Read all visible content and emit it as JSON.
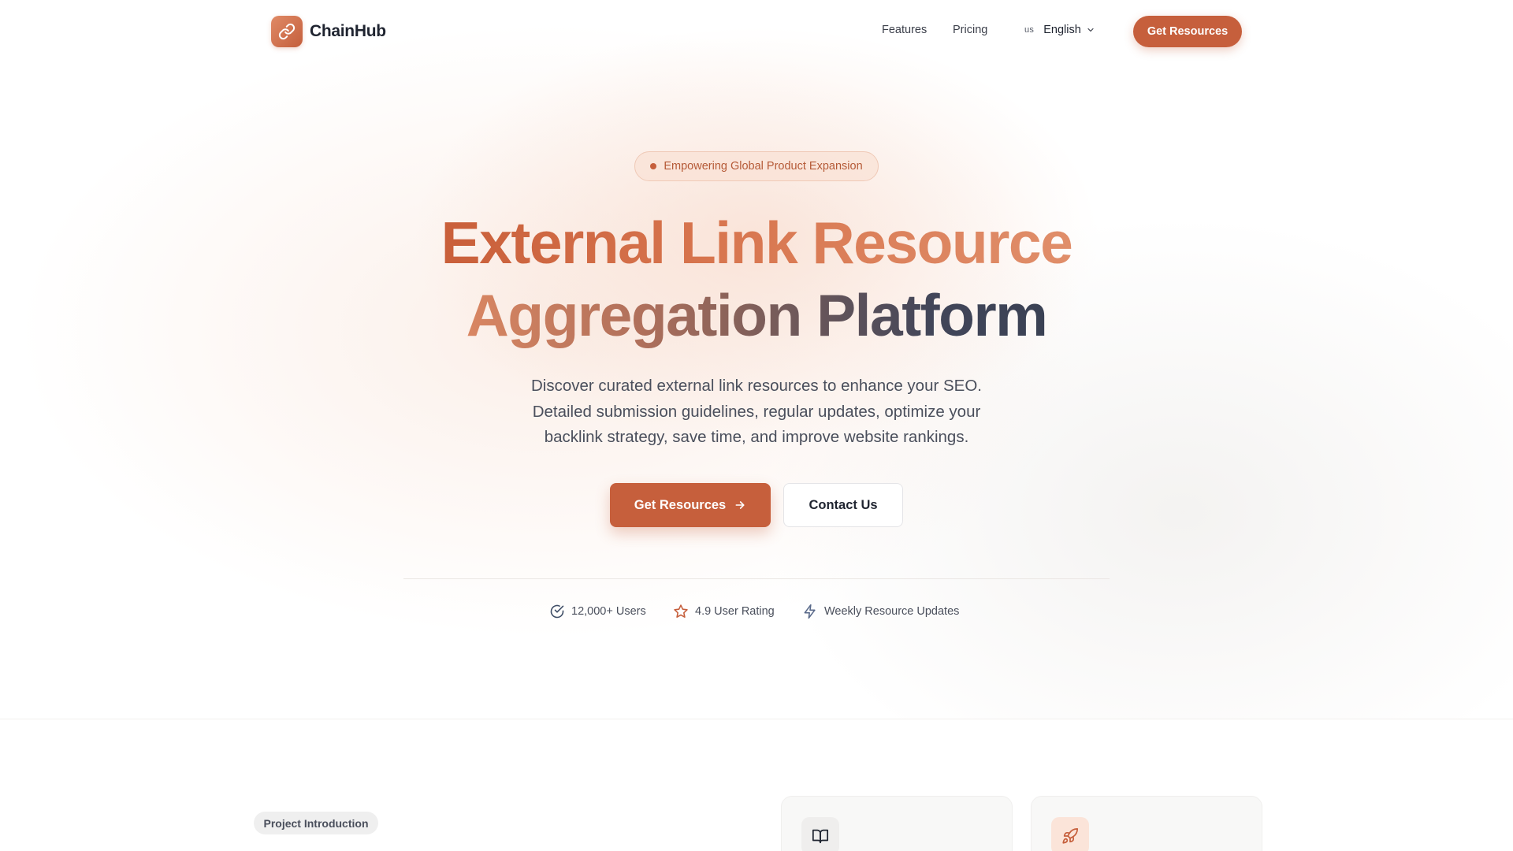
{
  "header": {
    "logo_text": "ChainHub",
    "nav": {
      "features": "Features",
      "pricing": "Pricing"
    },
    "language": {
      "code": "us",
      "label": "English"
    },
    "cta": "Get Resources"
  },
  "hero": {
    "badge": "Empowering Global Product Expansion",
    "title_line1": "External Link Resource",
    "title_line2": "Aggregation Platform",
    "subtitle_line1": "Discover curated external link resources to enhance your SEO.",
    "subtitle_line2": "Detailed submission guidelines, regular updates, optimize your",
    "subtitle_line3": "backlink strategy, save time, and improve website rankings.",
    "primary_button": "Get Resources",
    "secondary_button": "Contact Us"
  },
  "stats": {
    "users": "12,000+ Users",
    "rating": "4.9 User Rating",
    "updates": "Weekly Resource Updates"
  },
  "intro": {
    "pill": "Project Introduction"
  },
  "colors": {
    "accent": "#c65f3c",
    "text": "#1f2430",
    "muted": "#4a4f5c"
  },
  "icons": {
    "logo": "link-icon",
    "language_toggle": "chevron-down-icon",
    "primary_button": "arrow-right-icon",
    "users": "check-circle-icon",
    "rating": "star-icon",
    "updates": "lightning-icon",
    "card1": "book-open-icon",
    "card2": "rocket-icon"
  }
}
